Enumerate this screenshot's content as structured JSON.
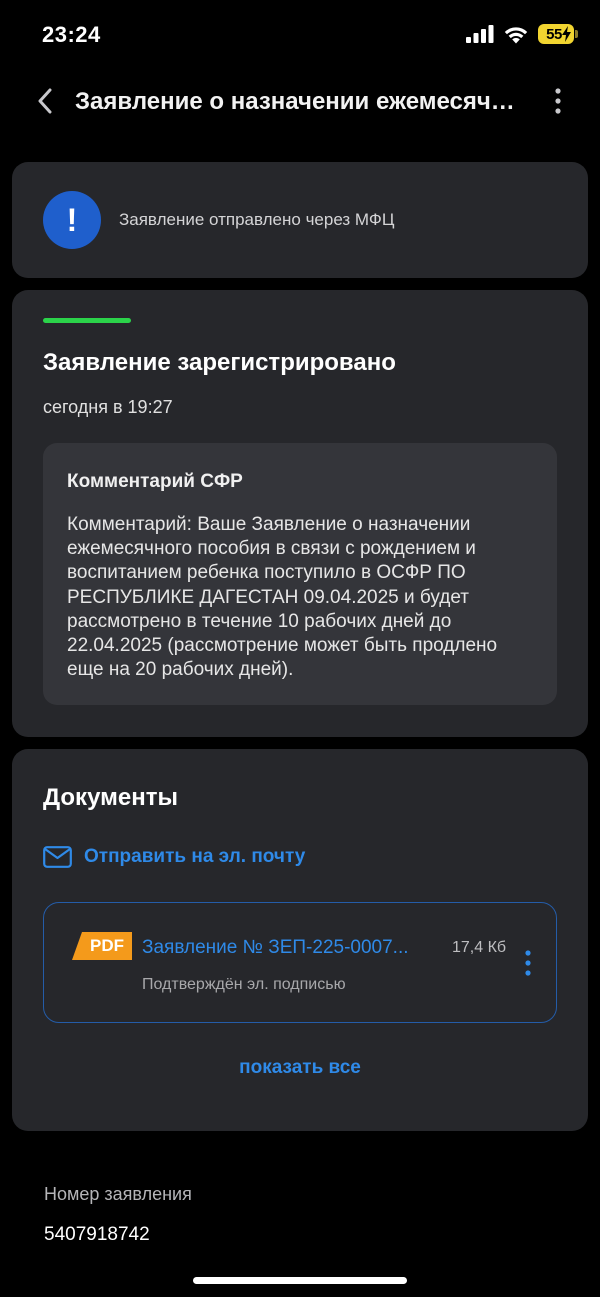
{
  "status_bar": {
    "time": "23:24",
    "battery": "55"
  },
  "header": {
    "title": "Заявление о назначении ежемесячного пособия в связи с рождением и воспитанием ребенка"
  },
  "notice": {
    "text": "Заявление отправлено через МФЦ",
    "icon": "exclamation-icon",
    "color": "#1f5fcc"
  },
  "status": {
    "title": "Заявление зарегистрировано",
    "date": "сегодня в 19:27",
    "progress_color": "#2bd34a",
    "comment": {
      "title": "Комментарий СФР",
      "text": "Комментарий: Ваше Заявление о назначении ежемесячного пособия в связи с рождением и воспитанием ребенка поступило в ОСФР ПО РЕСПУБЛИКЕ ДАГЕСТАН 09.04.2025 и будет рассмотрено в течение 10 рабочих дней до 22.04.2025 (рассмотрение может быть продлено еще на 20 рабочих дней)."
    }
  },
  "documents": {
    "title": "Документы",
    "send_email": "Отправить на эл. почту",
    "items": [
      {
        "badge": "PDF",
        "name": "Заявление № ЗЕП-225-0007...",
        "size": "17,4 Кб",
        "subtitle": "Подтверждён эл. подписью"
      }
    ],
    "show_all": "показать все",
    "accent_color": "#2f8ae8"
  },
  "application": {
    "label": "Номер заявления",
    "number": "5407918742"
  }
}
